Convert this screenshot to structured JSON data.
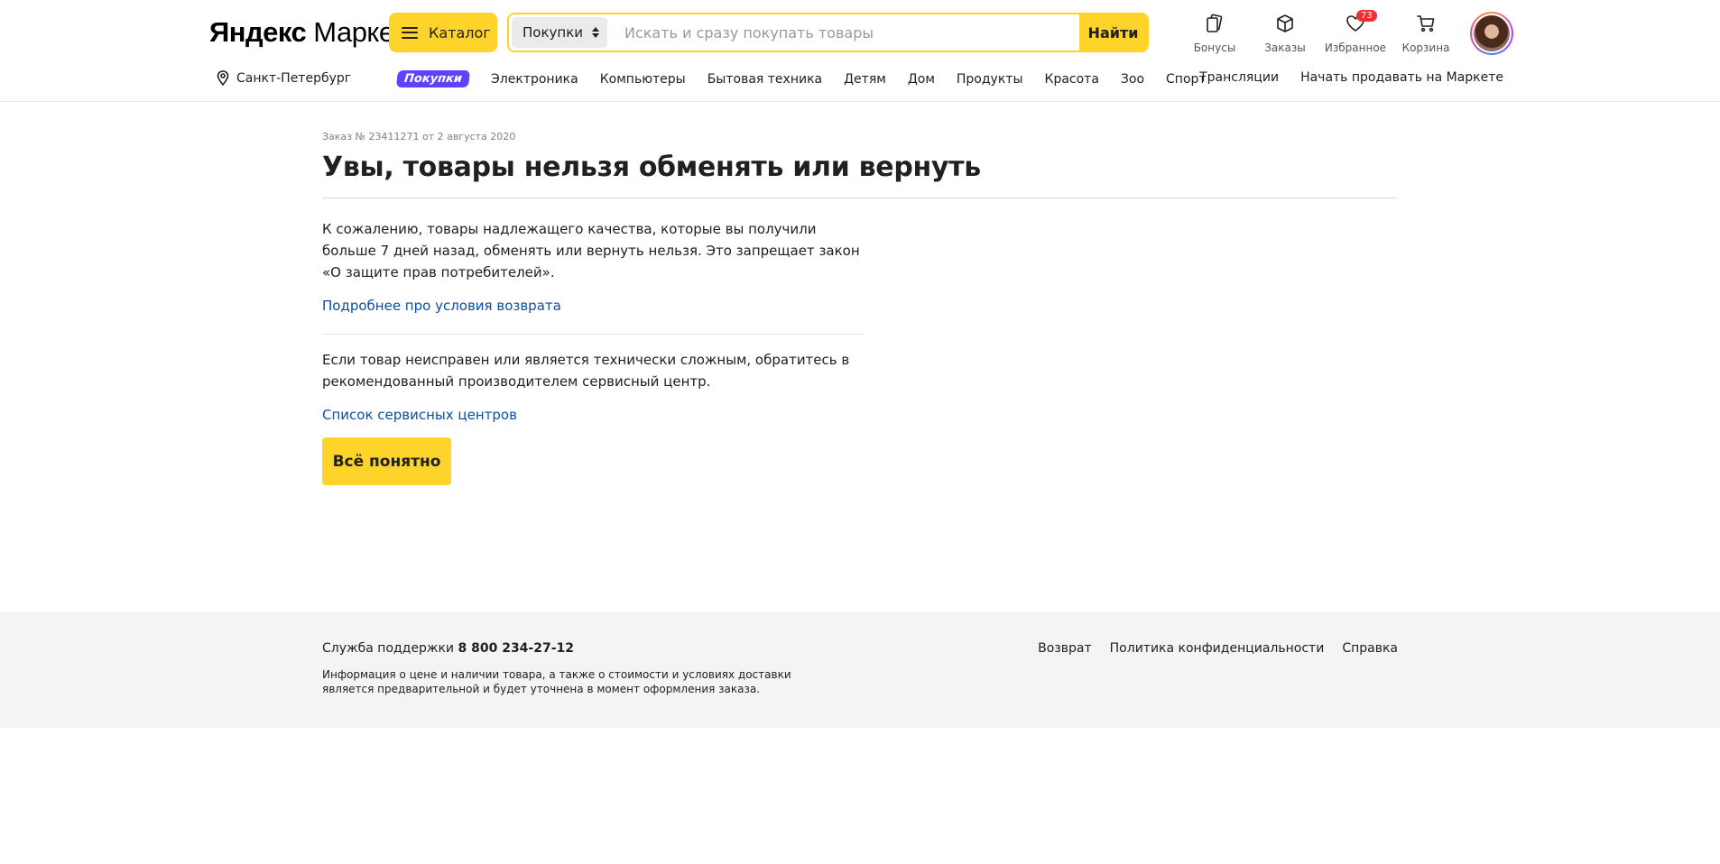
{
  "header": {
    "logo_part1": "Яндекс",
    "logo_part2": "Маркет",
    "catalog_label": "Каталог",
    "search": {
      "scope": "Покупки",
      "placeholder": "Искать и сразу покупать товары",
      "value": "",
      "button": "Найти"
    },
    "icons": [
      {
        "label": "Бонусы",
        "icon": "bonus-icon"
      },
      {
        "label": "Заказы",
        "icon": "box-icon"
      },
      {
        "label": "Избранное",
        "icon": "heart-icon",
        "badge": "73"
      },
      {
        "label": "Корзина",
        "icon": "cart-icon"
      }
    ],
    "city": "Санкт-Петербург",
    "nav_pill": "Покупки",
    "nav": [
      "Электроника",
      "Компьютеры",
      "Бытовая техника",
      "Детям",
      "Дом",
      "Продукты",
      "Красота",
      "Зоо",
      "Спорт"
    ],
    "nav_right": [
      "Трансляции",
      "Начать продавать на Маркете"
    ]
  },
  "main": {
    "order_meta": "Заказ № 23411271 от 2 августа 2020",
    "title": "Увы, товары нельзя обменять или вернуть",
    "para1": "К сожалению, товары надлежащего качества, которые вы получили больше 7 дней назад, обменять или вернуть нельзя. Это запрещает закон «О защите прав потребителей».",
    "link1": "Подробнее про условия возврата",
    "para2": "Если товар неисправен или является технически сложным, обратитесь в рекомендованный производителем сервисный центр.",
    "link2": "Список сервисных центров",
    "button": "Всё понятно"
  },
  "footer": {
    "support_label": "Служба поддержки",
    "support_phone": "8 800 234-27-12",
    "disclaimer": "Информация о цене и наличии товара, а также о стоимости и условиях доставки является предварительной и будет уточнена в момент оформления заказа.",
    "links": [
      "Возврат",
      "Политика конфиденциальности",
      "Справка"
    ]
  },
  "colors": {
    "accent_yellow": "#fed42b",
    "pill_purple": "#6240ff",
    "link_blue": "#0a4fa6",
    "badge_red": "#f22e2e"
  }
}
